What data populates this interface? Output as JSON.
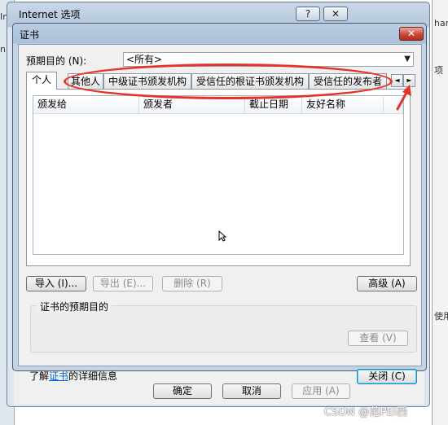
{
  "background": {
    "left_window": {
      "t1": "Int",
      "t2": "nk"
    },
    "right_window": {
      "t1": "har",
      "t2": "项",
      "t3": "使用"
    }
  },
  "outer_window": {
    "title": "Internet 选项",
    "help_label": "?",
    "close_label": "✕",
    "buttons": {
      "ok": "确定",
      "cancel": "取消",
      "apply": "应用 (A)"
    }
  },
  "dialog": {
    "title": "证书",
    "close_label": "✕",
    "purpose_label": "预期目的 (N):",
    "purpose_value": "<所有>",
    "tabs": [
      "个人",
      "其他人",
      "中级证书颁发机构",
      "受信任的根证书颁发机构",
      "受信任的发布者"
    ],
    "columns": [
      "颁发给",
      "颁发者",
      "截止日期",
      "友好名称"
    ],
    "buttons": {
      "import": "导入 (I)...",
      "export": "导出 (E)...",
      "remove": "删除 (R)",
      "advanced": "高级 (A)",
      "view": "查看 (V)",
      "close": "关闭 (C)"
    },
    "purposes_group_label": "证书的预期目的",
    "learn_prefix": "了解",
    "learn_link": "证书",
    "learn_suffix": "的详细信息"
  },
  "colors": {
    "annotation": "#e5332a",
    "link": "#0066cc",
    "dialog_close": "#c8483a"
  },
  "icons": {
    "tab_scroll_left": "◄",
    "tab_scroll_right": "►",
    "combo_arrow": "▼"
  },
  "watermark": "CSDN @范PEI西"
}
